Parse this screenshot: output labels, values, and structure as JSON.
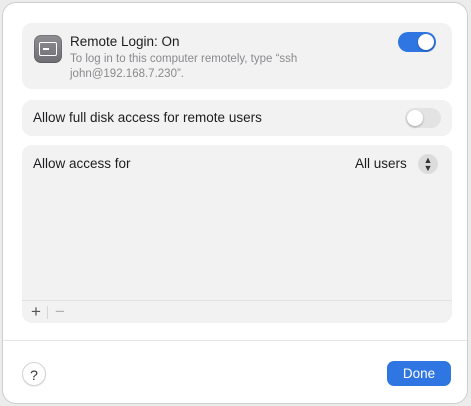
{
  "remote_login": {
    "title": "Remote Login: On",
    "description": "To log in to this computer remotely, type “ssh john@192.168.7.230”.",
    "toggle_state": "on",
    "icon": "terminal-icon"
  },
  "full_disk": {
    "label": "Allow full disk access for remote users",
    "toggle_state": "off"
  },
  "access": {
    "label": "Allow access for",
    "selected": "All users",
    "add_label": "+",
    "remove_label": "−"
  },
  "footer": {
    "help_label": "?",
    "done_label": "Done"
  },
  "colors": {
    "accent": "#2f76e3",
    "card_bg": "#f2f2f2"
  }
}
